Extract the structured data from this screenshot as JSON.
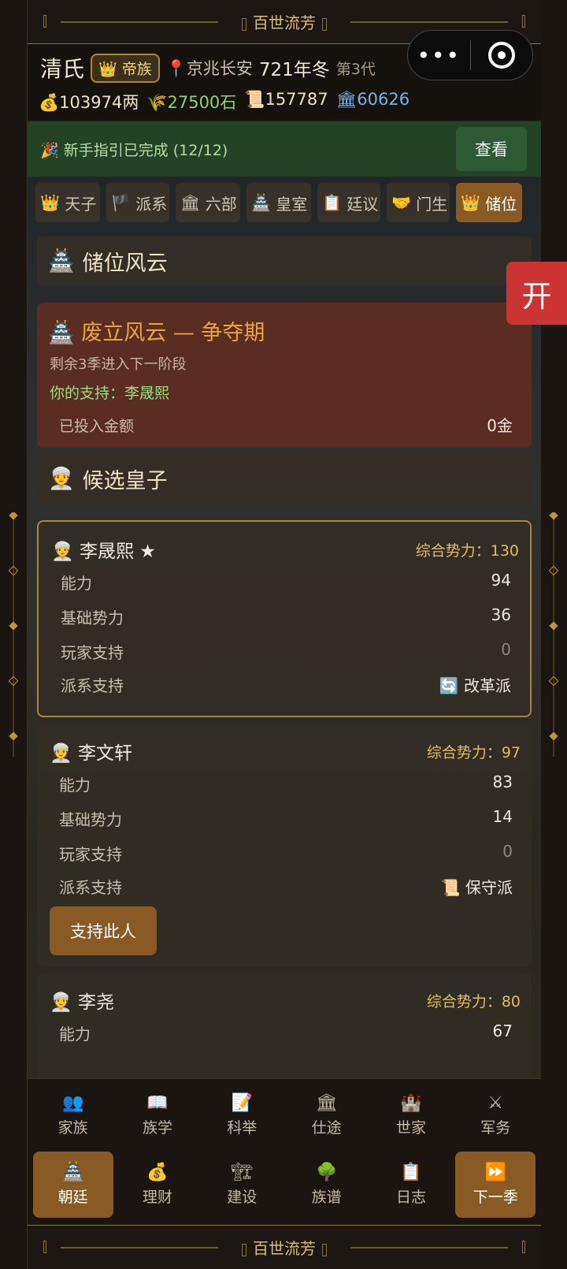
{
  "banner_title": "百世流芳",
  "header": {
    "clan": "清氏",
    "rank_icon": "👑",
    "rank": "帝族",
    "location": "京兆长安",
    "year": "721年冬",
    "generation": "第3代",
    "money": "103974两",
    "grain": "27500石",
    "prestige": "157787",
    "office": "60626",
    "icons": {
      "money": "💰",
      "grain": "🌾",
      "prestige": "📜",
      "office": "🏛",
      "location": "📍"
    }
  },
  "guide": {
    "text": "🎉 新手指引已完成 (12/12)",
    "button": "查看"
  },
  "tabs": [
    {
      "icon": "👑",
      "label": "天子"
    },
    {
      "icon": "🏴",
      "label": "派系"
    },
    {
      "icon": "🏛",
      "label": "六部"
    },
    {
      "icon": "🏯",
      "label": "皇室"
    },
    {
      "icon": "📋",
      "label": "廷议"
    },
    {
      "icon": "🤝",
      "label": "门生"
    },
    {
      "icon": "👑",
      "label": "储位"
    }
  ],
  "section_title": {
    "icon": "🏯",
    "label": "储位风云"
  },
  "phase": {
    "title": "🏯 废立风云 — 争夺期",
    "sub": "剩余3季进入下一阶段",
    "support": "你的支持：李晟熙",
    "invested_label": "已投入金额",
    "invested_value": "0金"
  },
  "candidates_title": {
    "icon": "👳",
    "label": "候选皇子"
  },
  "row_labels": {
    "ability": "能力",
    "base": "基础势力",
    "player": "玩家支持",
    "faction": "派系支持"
  },
  "candidates": [
    {
      "name": "👳 李晟熙 ★",
      "power": "综合势力：130",
      "ability": "94",
      "base": "36",
      "player": "0",
      "faction": "🔄 改革派"
    },
    {
      "name": "👳 李文轩",
      "power": "综合势力：97",
      "ability": "83",
      "base": "14",
      "player": "0",
      "faction": "📜 保守派",
      "button": "支持此人"
    },
    {
      "name": "👳 李尧",
      "power": "综合势力：80",
      "ability": "67"
    }
  ],
  "nav_row1": [
    {
      "icon": "👥",
      "label": "家族"
    },
    {
      "icon": "📖",
      "label": "族学"
    },
    {
      "icon": "📝",
      "label": "科举"
    },
    {
      "icon": "🏛",
      "label": "仕途"
    },
    {
      "icon": "🏰",
      "label": "世家"
    },
    {
      "icon": "⚔",
      "label": "军务"
    }
  ],
  "nav_row2": [
    {
      "icon": "🏯",
      "label": "朝廷"
    },
    {
      "icon": "💰",
      "label": "理财"
    },
    {
      "icon": "🏗",
      "label": "建设"
    },
    {
      "icon": "🌳",
      "label": "族谱"
    },
    {
      "icon": "📋",
      "label": "日志"
    },
    {
      "icon": "⏩",
      "label": "下一季"
    }
  ],
  "float_button": "开"
}
